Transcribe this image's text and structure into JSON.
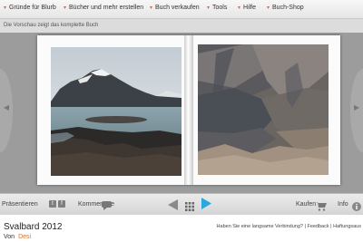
{
  "nav": {
    "items": [
      {
        "label": "Gründe für Blurb"
      },
      {
        "label": "Bücher und mehr erstellen"
      },
      {
        "label": "Buch verkaufen"
      },
      {
        "label": "Tools"
      },
      {
        "label": "Hilfe"
      },
      {
        "label": "Buch-Shop"
      }
    ]
  },
  "notice": "Die Vorschau zeigt das komplette Buch",
  "icons": {
    "nav": "chevron-down-icon",
    "prev": "arrow-left-icon",
    "grid": "grid-icon",
    "next": "arrow-right-icon",
    "comment": "speech-bubble-icon",
    "cart": "cart-icon",
    "info": "info-icon"
  },
  "toolbar": {
    "present_label": "Präsentieren",
    "comments_label": "Kommentare",
    "buy_label": "Kaufen",
    "info_label": "Info",
    "small_btn_1": "t",
    "small_btn_2": "f"
  },
  "book": {
    "title": "Svalbard 2012",
    "by_label": "Von",
    "author": "Desi"
  },
  "help": {
    "slow_connection": "Haben Sie eine langsame Verbindung?",
    "separator": "|",
    "feedback": "Feedback",
    "terms": "Haftungsaus"
  },
  "colors": {
    "accent": "#e07020",
    "play": "#2aa7dc",
    "stage": "#9c9c9c"
  }
}
